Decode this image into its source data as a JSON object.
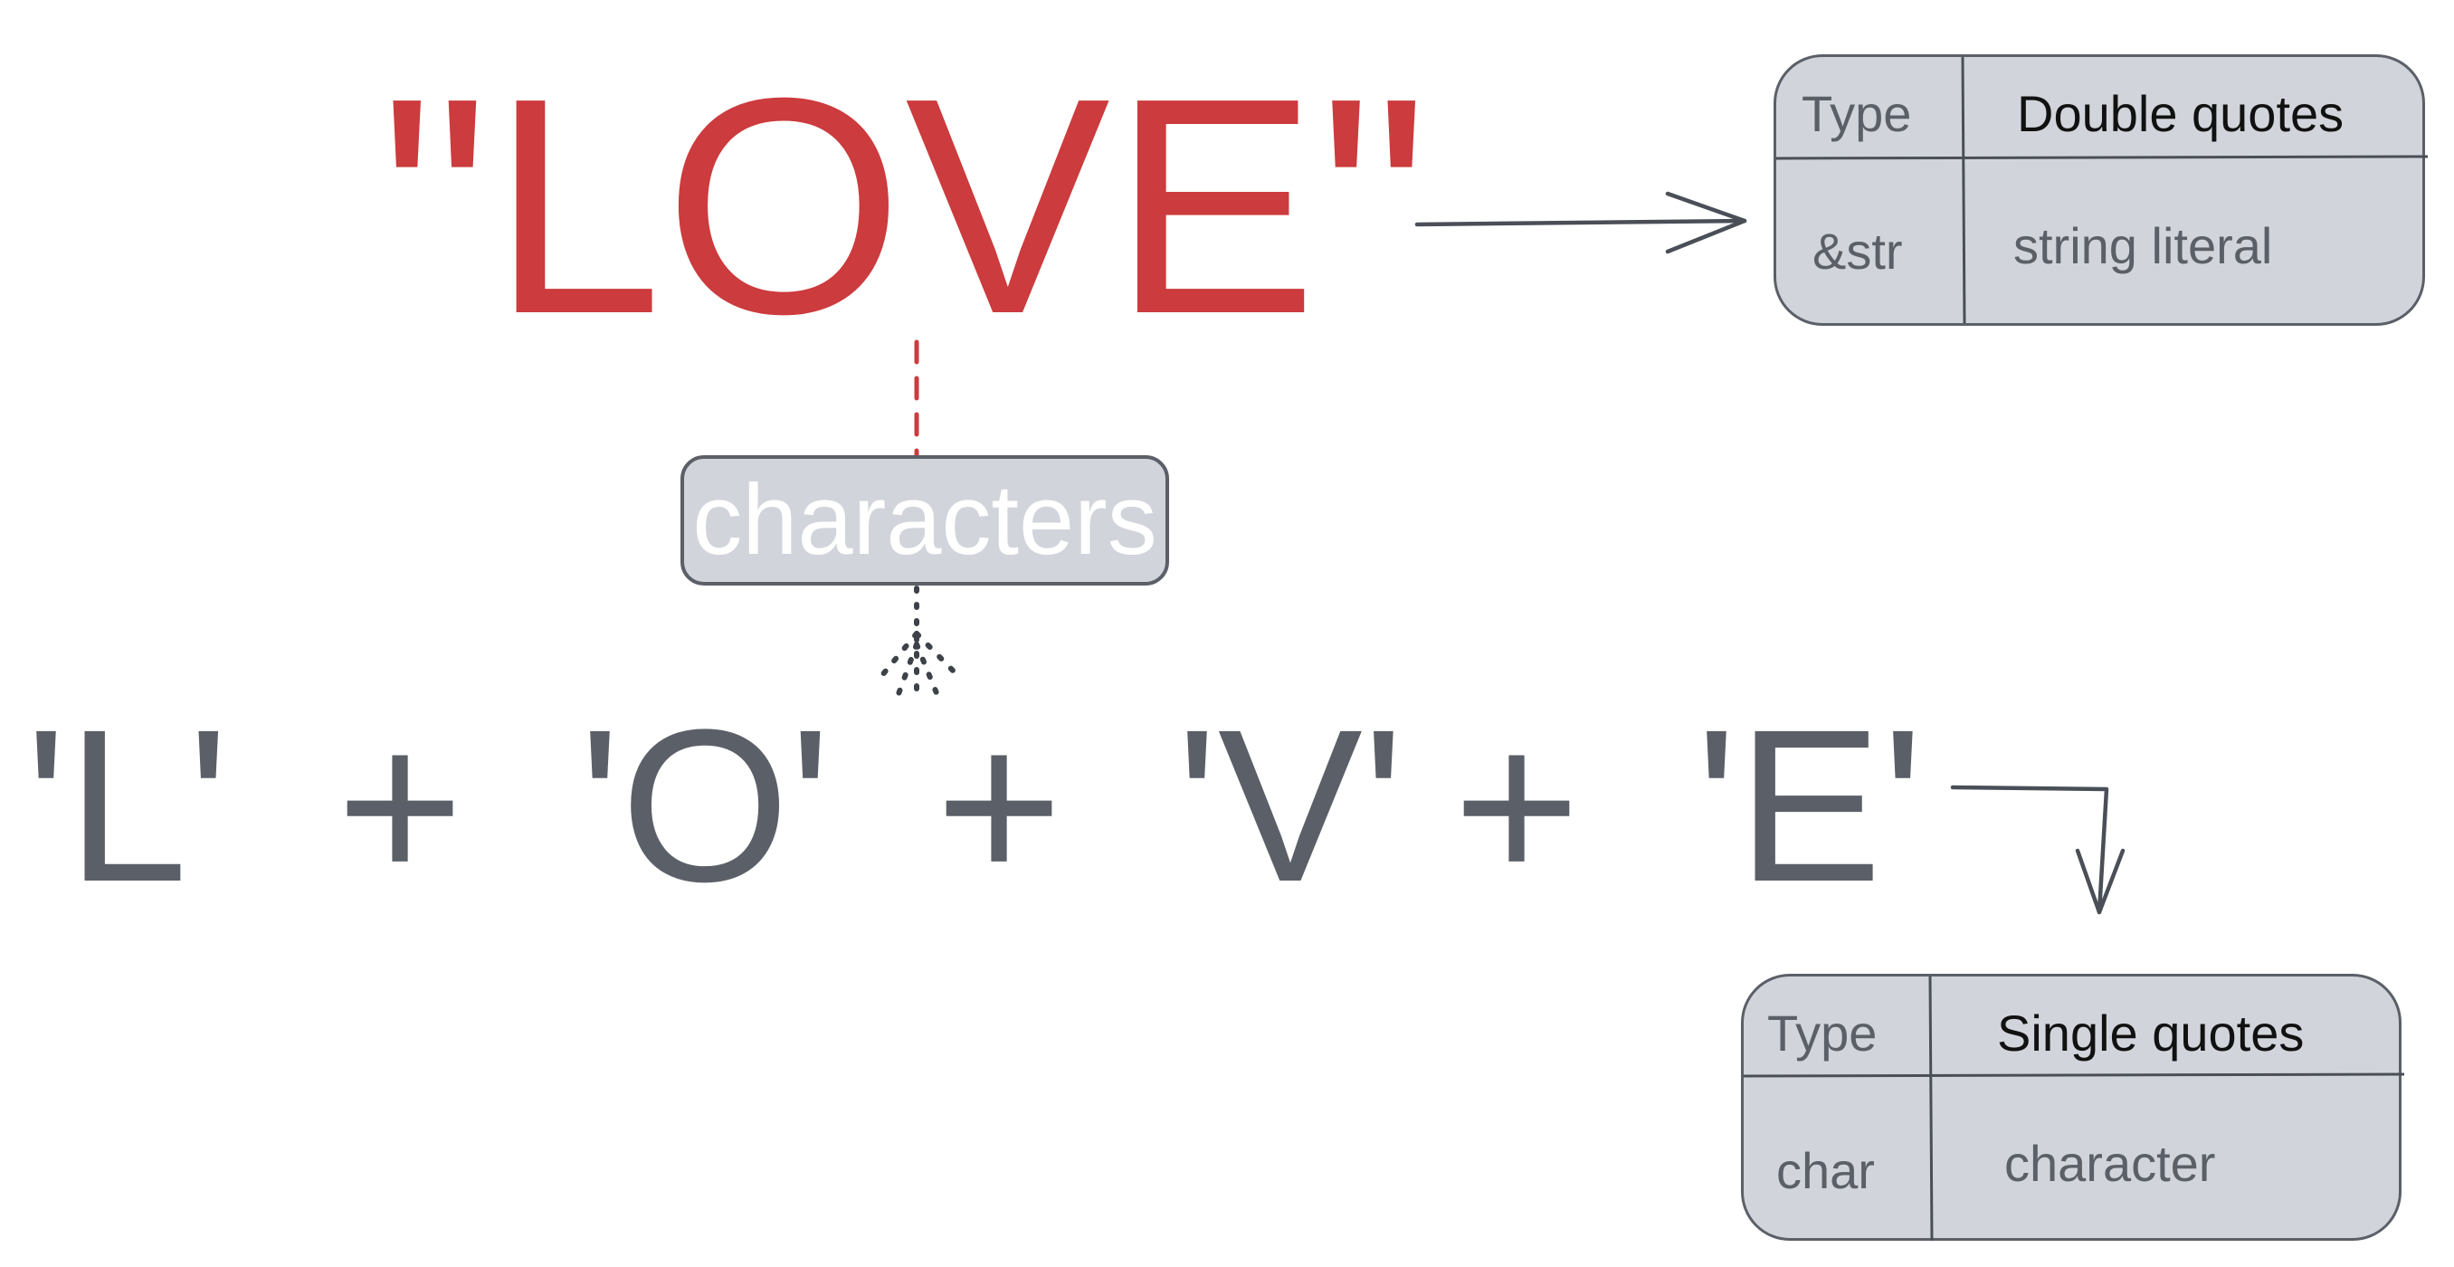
{
  "word": {
    "text": "\"LOVE\"",
    "color": "#cc3b3d"
  },
  "chars": [
    {
      "text": "'L'"
    },
    {
      "text": "'O'"
    },
    {
      "text": "'V'"
    },
    {
      "text": "'E'"
    }
  ],
  "operator": "+",
  "chip": {
    "label": "characters"
  },
  "string_card": {
    "header_key": "Type",
    "header_value": "Double quotes",
    "type_name": "&str",
    "description": "string literal"
  },
  "char_card": {
    "header_key": "Type",
    "header_value": "Single quotes",
    "type_name": "char",
    "description": "character"
  },
  "colors": {
    "accent": "#cc3b3d",
    "gray": "#5b6068",
    "card_fill": "#d1d5db"
  }
}
